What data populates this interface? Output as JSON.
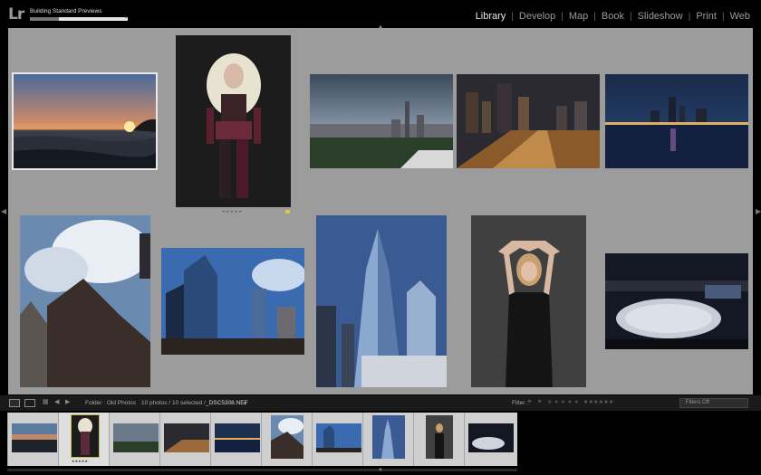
{
  "app": {
    "logo": "Lr"
  },
  "task": {
    "label": "Building Standard Previews",
    "progress_fraction": 0.3
  },
  "modules": [
    {
      "label": "Library",
      "active": true
    },
    {
      "label": "Develop",
      "active": false
    },
    {
      "label": "Map",
      "active": false
    },
    {
      "label": "Book",
      "active": false
    },
    {
      "label": "Slideshow",
      "active": false
    },
    {
      "label": "Print",
      "active": false
    },
    {
      "label": "Web",
      "active": false
    }
  ],
  "grid": {
    "photos": [
      {
        "name": "sunset-seascape",
        "selected": true
      },
      {
        "name": "cosplay-portrait",
        "selected": false,
        "rating_stars": "★★★★★"
      },
      {
        "name": "city-skyline-park",
        "selected": false
      },
      {
        "name": "pier-night-city",
        "selected": false
      },
      {
        "name": "lakefront-night-skyline",
        "selected": false
      },
      {
        "name": "skyscrapers-clouds",
        "selected": false
      },
      {
        "name": "glass-towers-blue-sky",
        "selected": false
      },
      {
        "name": "one-world-trade-center",
        "selected": false
      },
      {
        "name": "woman-black-dress",
        "selected": false
      },
      {
        "name": "ice-rink-night",
        "selected": false
      }
    ],
    "reject_symbol": "✕"
  },
  "filmstrip_bar": {
    "source": "Folder : Old Photos",
    "count": "10 photos / 10 selected /",
    "filename": "_DSC5308.NEF",
    "dropdown_symbol": "▾",
    "filter_label": "Filter :",
    "filter_glyphs": "⚑ ⚑ ★★★★★ ■■■■■■",
    "filters_off": "Filters Off"
  },
  "filmstrip": {
    "thumb_stars": "★★★★★"
  },
  "colors": {
    "grid_bg": "#9c9c9c",
    "active_module": "#e8e8e8",
    "inactive_module": "#9a9a9a",
    "flag": "#d8c94a"
  }
}
